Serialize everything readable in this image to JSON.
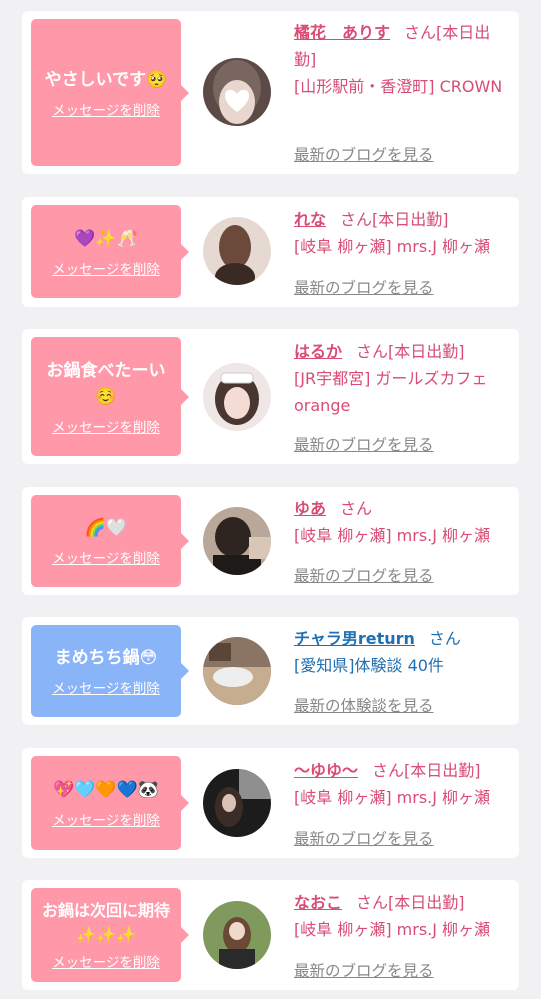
{
  "delete_label": "メッセージを削除",
  "suffix": "さん",
  "colors": {
    "pink_bubble": "#ff99aa",
    "blue_bubble": "#8ab4f8",
    "girl_text": "#d94c74",
    "guy_text": "#1f6fb2",
    "link_gray": "#888888"
  },
  "cards": [
    {
      "message": "やさしいです🥺",
      "name": "橘花　ありす",
      "status": "[本日出勤]",
      "details": "[山形駅前・香澄町] CROWN",
      "link": "最新のブログを見る"
    },
    {
      "message": "💜✨🥂",
      "name": "れな",
      "status": "[本日出勤]",
      "details": "[岐阜 柳ヶ瀬] mrs.J 柳ヶ瀬",
      "link": "最新のブログを見る"
    },
    {
      "message": "お鍋食べたーい☺️",
      "name": "はるか",
      "status": "[本日出勤]",
      "details": "[JR宇都宮] ガールズカフェ orange",
      "link": "最新のブログを見る"
    },
    {
      "message": "🌈🤍",
      "name": "ゆあ",
      "status": "",
      "details": "[岐阜 柳ヶ瀬] mrs.J 柳ヶ瀬",
      "link": "最新のブログを見る"
    },
    {
      "message": "まめちち鍋😳",
      "name": "チャラ男return",
      "status": "",
      "details": "[愛知県]体験談 40件",
      "link": "最新の体験談を見る"
    },
    {
      "message": "💖🩵🧡💙🐼",
      "name": "〜ゆゆ〜",
      "status": "[本日出勤]",
      "details": "[岐阜 柳ヶ瀬] mrs.J 柳ヶ瀬",
      "link": "最新のブログを見る"
    },
    {
      "message": "お鍋は次回に期待✨✨✨",
      "name": "なおこ",
      "status": "[本日出勤]",
      "details": "[岐阜 柳ヶ瀬] mrs.J 柳ヶ瀬",
      "link": "最新のブログを見る"
    }
  ]
}
